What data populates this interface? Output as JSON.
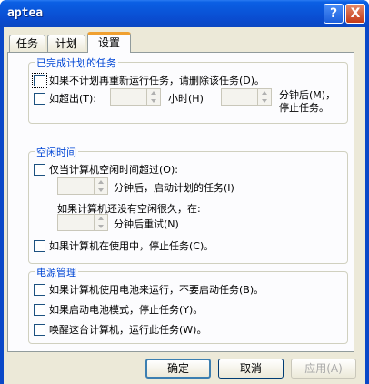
{
  "window": {
    "title": "aptea",
    "help_button": "?",
    "close_button": "X"
  },
  "tabs": [
    {
      "label": "任务"
    },
    {
      "label": "计划"
    },
    {
      "label": "设置"
    }
  ],
  "completed_group": {
    "title": "已完成计划的任务",
    "delete_if_not_rescheduled": "如果不计划再重新运行任务，请删除该任务(D)。",
    "stop_if_runs_for": "如超出(T):",
    "hours_label": "小时(H)",
    "minutes_label_line1": "分钟后(M)，",
    "minutes_label_line2": "停止任务。"
  },
  "idle_group": {
    "title": "空闲时间",
    "only_start_if_idle": "仅当计算机空闲时间超过(O):",
    "minutes_then_start": "分钟后，启动计划的任务(I)",
    "if_not_idle_long": "如果计算机还没有空闲很久，在:",
    "minutes_retry": "分钟后重试(N)",
    "stop_if_in_use": "如果计算机在使用中，停止任务(C)。"
  },
  "power_group": {
    "title": "电源管理",
    "dont_start_on_battery": "如果计算机使用电池来运行，不要启动任务(B)。",
    "stop_on_battery_mode": "如果启动电池模式，停止任务(Y)。",
    "wake_to_run": "唤醒这台计算机，运行此任务(W)。"
  },
  "buttons": {
    "ok": "确定",
    "cancel": "取消",
    "apply": "应用(A)"
  }
}
